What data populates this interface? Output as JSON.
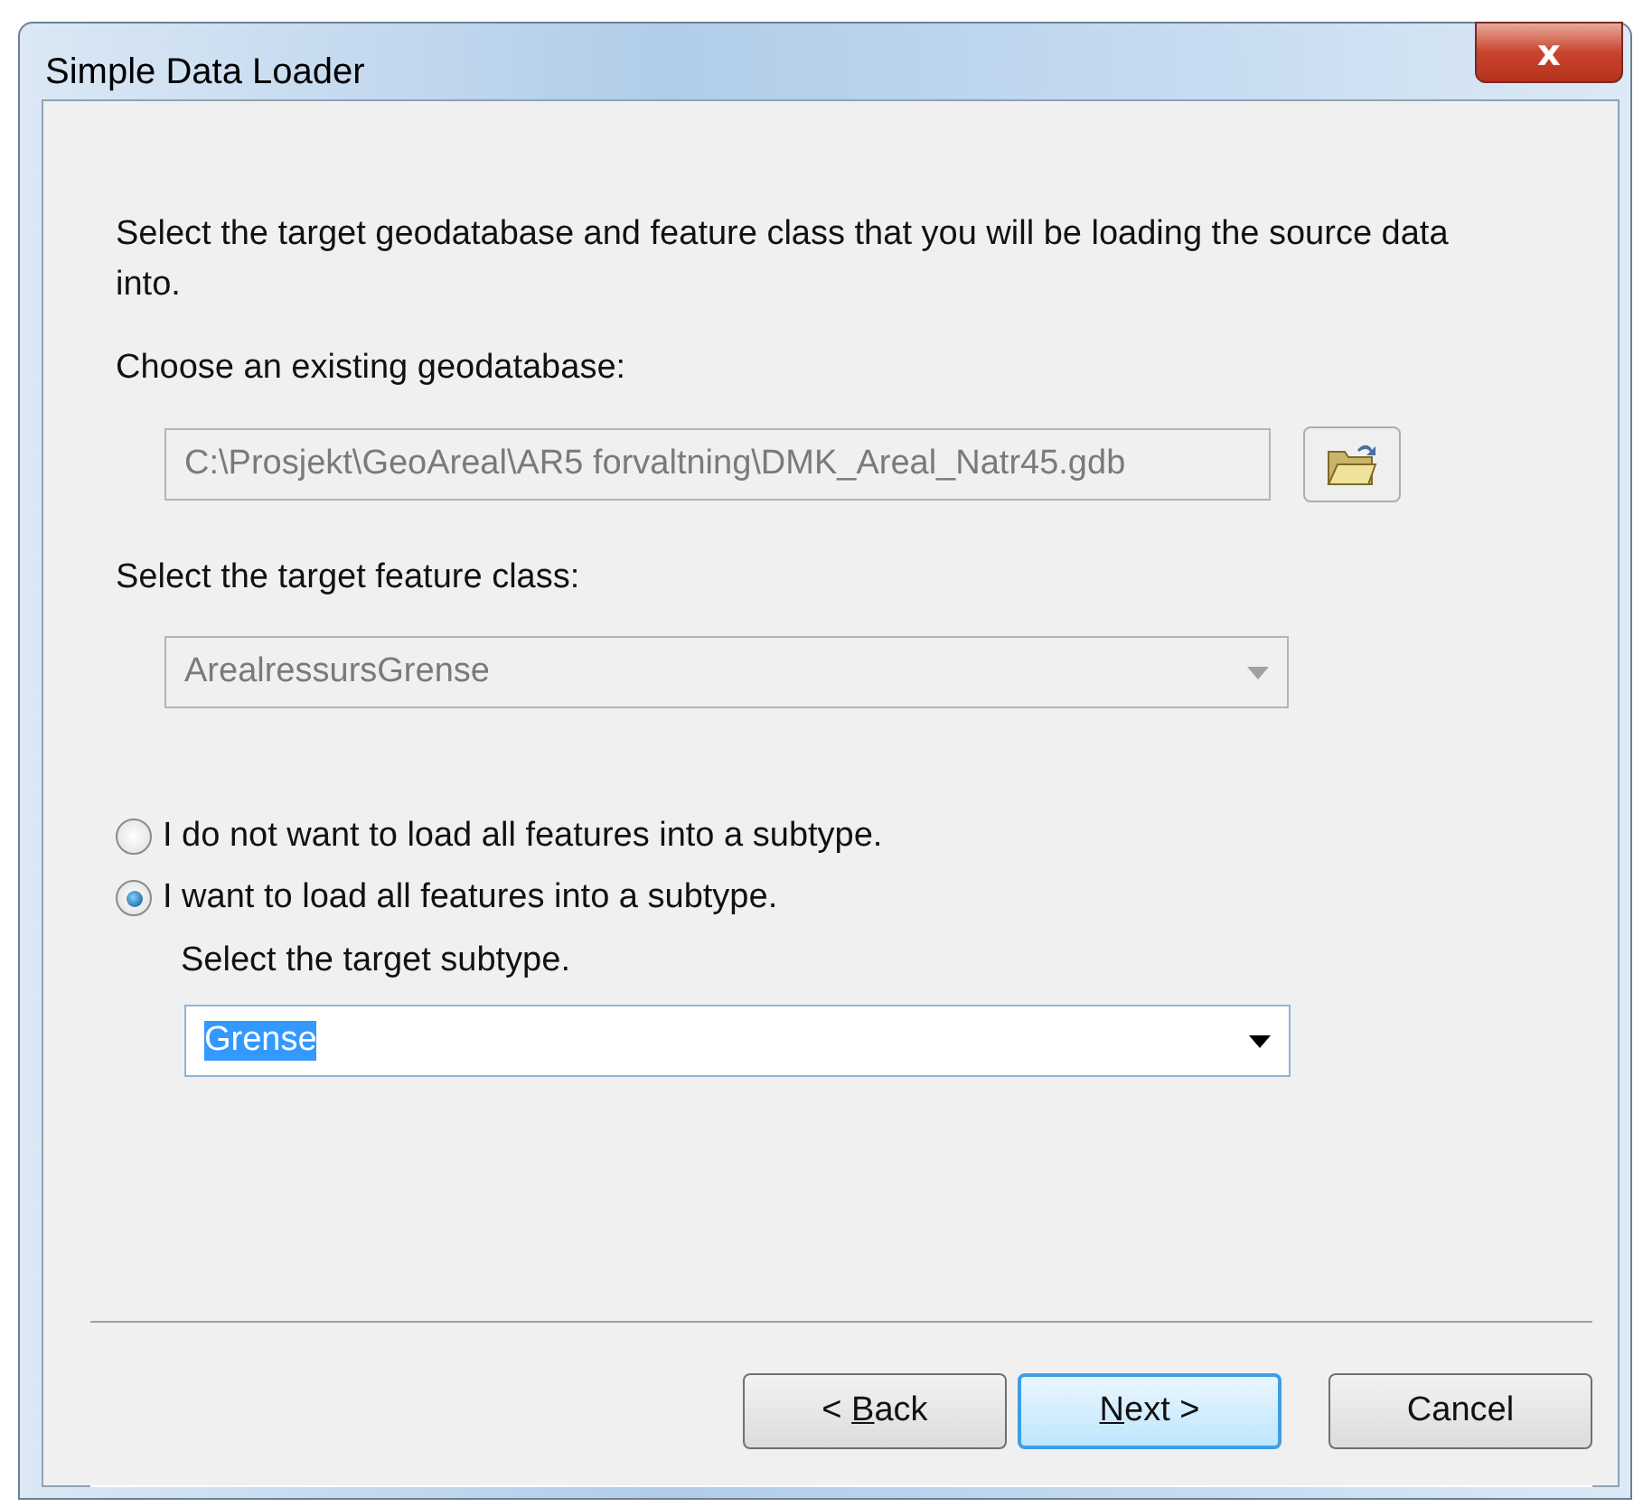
{
  "window": {
    "title": "Simple Data Loader",
    "close_glyph": "x"
  },
  "intro": "Select the target geodatabase and feature class that you will be loading the source data into.",
  "geodatabase": {
    "label": "Choose an existing geodatabase:",
    "value": "C:\\Prosjekt\\GeoAreal\\AR5 forvaltning\\DMK_Areal_Natr45.gdb",
    "disabled": true
  },
  "feature_class": {
    "label": "Select the target feature class:",
    "value": "ArealressursGrense",
    "disabled": true
  },
  "options": [
    {
      "label": "I do not want to load all features into a subtype.",
      "selected": false
    },
    {
      "label": "I want to load all features into a subtype.",
      "selected": true
    }
  ],
  "subtype": {
    "label": "Select the target subtype.",
    "value": "Grense",
    "text_selected": true
  },
  "buttons": [
    {
      "before": "< ",
      "key": "B",
      "after": "ack",
      "default": false
    },
    {
      "key": "N",
      "after": "ext >",
      "default": true
    },
    {
      "before": "Cancel",
      "default": false
    }
  ]
}
